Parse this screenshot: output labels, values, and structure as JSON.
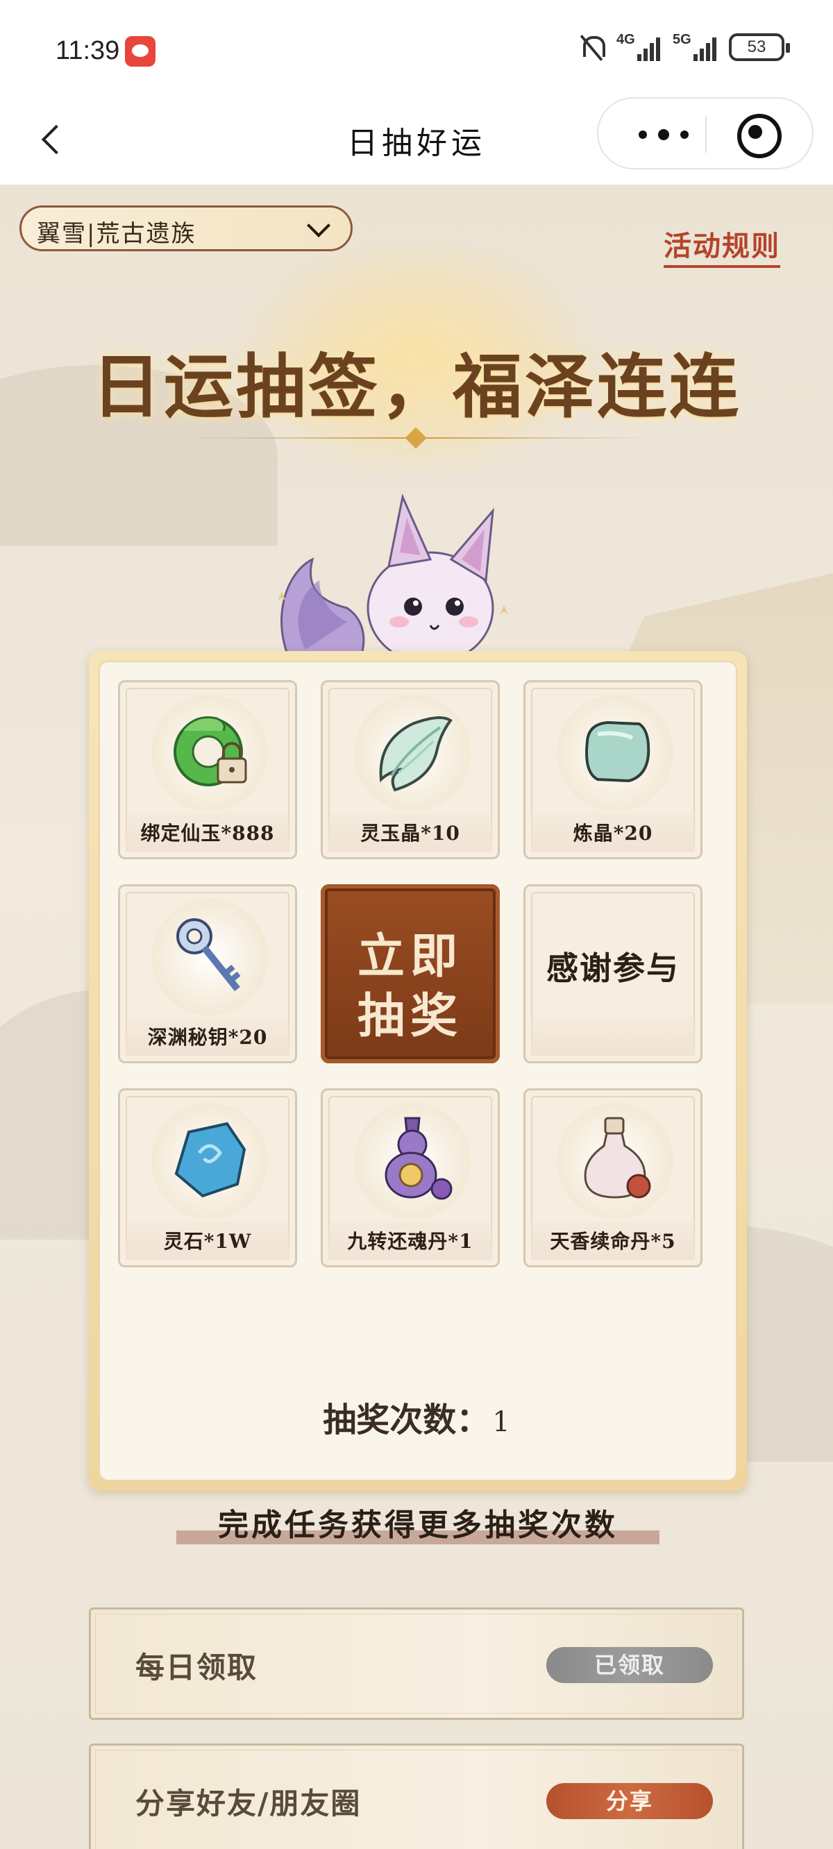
{
  "status_bar": {
    "time": "11:39",
    "network_4g": "4G",
    "network_5g": "5G",
    "battery": "53"
  },
  "nav": {
    "title": "日抽好运"
  },
  "header": {
    "server_select": "翼雪|荒古遗族",
    "rules_link": "活动规则",
    "headline": "日运抽签，福泽连连"
  },
  "prizes": [
    {
      "label": "绑定仙玉*888",
      "icon": "jade-dragon-icon"
    },
    {
      "label": "灵玉晶*10",
      "icon": "jade-crystal-icon"
    },
    {
      "label": "炼晶*20",
      "icon": "refine-crystal-icon"
    },
    {
      "label": "深渊秘钥*20",
      "icon": "abyss-key-icon"
    },
    {
      "label": "感谢参与",
      "icon": ""
    },
    {
      "label": "灵石*1W",
      "icon": "spirit-stone-icon"
    },
    {
      "label": "九转还魂丹*1",
      "icon": "revive-pill-icon"
    },
    {
      "label": "天香续命丹*5",
      "icon": "life-pill-icon"
    }
  ],
  "draw_button": {
    "line1": "立即",
    "line2": "抽奖"
  },
  "draw_count": {
    "label": "抽奖次数：",
    "value": "1"
  },
  "tasks_heading": "完成任务获得更多抽奖次数",
  "tasks": [
    {
      "name": "每日领取",
      "button": "已领取",
      "state": "claimed"
    },
    {
      "name": "分享好友/朋友圈",
      "button": "分享",
      "state": "available"
    }
  ],
  "colors": {
    "accent": "#b5432a",
    "draw_button": "#8a4420",
    "claimed_button": "#8f8f8f",
    "share_button": "#c0603a"
  }
}
